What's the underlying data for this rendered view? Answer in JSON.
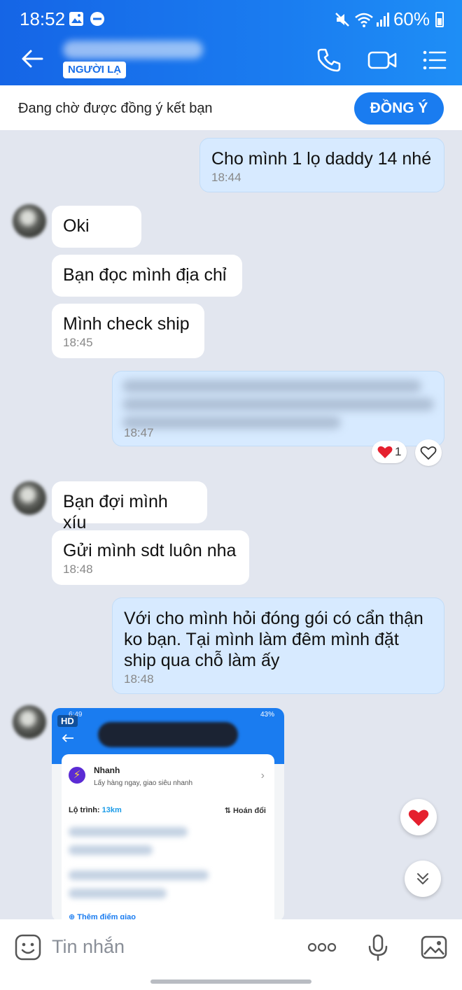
{
  "status_bar": {
    "time": "18:52",
    "battery": "60%"
  },
  "header": {
    "badge": "NGƯỜI LẠ"
  },
  "friend_request": {
    "text": "Đang chờ được đồng ý kết bạn",
    "accept_label": "ĐỒNG Ý"
  },
  "messages": {
    "m1": {
      "text": "Cho mình 1 lọ daddy 14 nhé",
      "time": "18:44"
    },
    "m2": {
      "text": "Oki"
    },
    "m3": {
      "text": "Bạn đọc mình địa chỉ"
    },
    "m4": {
      "text": "Mình check ship",
      "time": "18:45"
    },
    "m5": {
      "time": "18:47",
      "reaction_count": "1"
    },
    "m6": {
      "text": "Bạn đợi mình xíu"
    },
    "m7": {
      "text": "Gửi mình sdt luôn nha",
      "time": "18:48"
    },
    "m8": {
      "line1": "Với cho mình hỏi đóng gói có cẩn thận",
      "line2": "ko bạn. Tại mình làm đêm mình đặt",
      "line3": "ship qua chỗ làm ấy",
      "time": "18:48"
    }
  },
  "image_message": {
    "hd": "HD",
    "status_left": "6:49",
    "status_right": "43%",
    "card_title": "Nhanh",
    "card_subtitle": "Lấy hàng ngay, giao siêu nhanh",
    "route_label": "Lộ trình:",
    "route_km": "13km",
    "swap_label": "Hoán đổi",
    "add_stop": "Thêm điểm giao"
  },
  "input": {
    "placeholder": "Tin nhắn"
  },
  "icons": [
    "back-arrow-icon",
    "phone-icon",
    "video-icon",
    "menu-icon",
    "heart-icon",
    "emoji-icon",
    "more-icon",
    "mic-icon",
    "image-icon",
    "chevron-double-down-icon"
  ],
  "colors": {
    "header_blue": "#1a7cf0",
    "out_bubble": "#d7eaff",
    "background": "#e2e6ef",
    "heart": "#e5202e"
  }
}
